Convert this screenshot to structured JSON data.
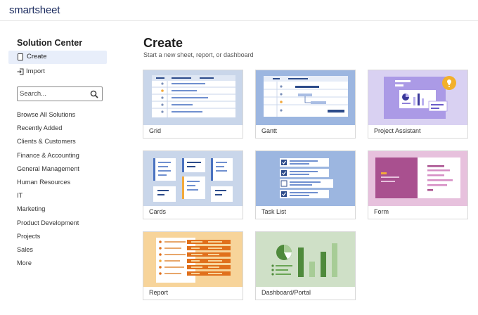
{
  "header": {
    "brand": "smartsheet"
  },
  "sidebar": {
    "title": "Solution Center",
    "create_label": "Create",
    "import_label": "Import",
    "search_placeholder": "Search...",
    "items": [
      "Browse All Solutions",
      "Recently Added",
      "Clients & Customers",
      "Finance & Accounting",
      "General Management",
      "Human Resources",
      "IT",
      "Marketing",
      "Product Development",
      "Projects",
      "Sales",
      "More"
    ]
  },
  "main": {
    "title": "Create",
    "subtitle": "Start a new sheet, report, or dashboard",
    "cards": [
      {
        "label": "Grid",
        "color": "#c9d6ea"
      },
      {
        "label": "Gantt",
        "color": "#9cb6e0"
      },
      {
        "label": "Project Assistant",
        "color": "#d9d1f2"
      },
      {
        "label": "Cards",
        "color": "#c9d6ea"
      },
      {
        "label": "Task List",
        "color": "#9cb6e0"
      },
      {
        "label": "Form",
        "color": "#e7c1dd"
      },
      {
        "label": "Report",
        "color": "#f7d49a"
      },
      {
        "label": "Dashboard/Portal",
        "color": "#cfe0c7"
      }
    ]
  }
}
